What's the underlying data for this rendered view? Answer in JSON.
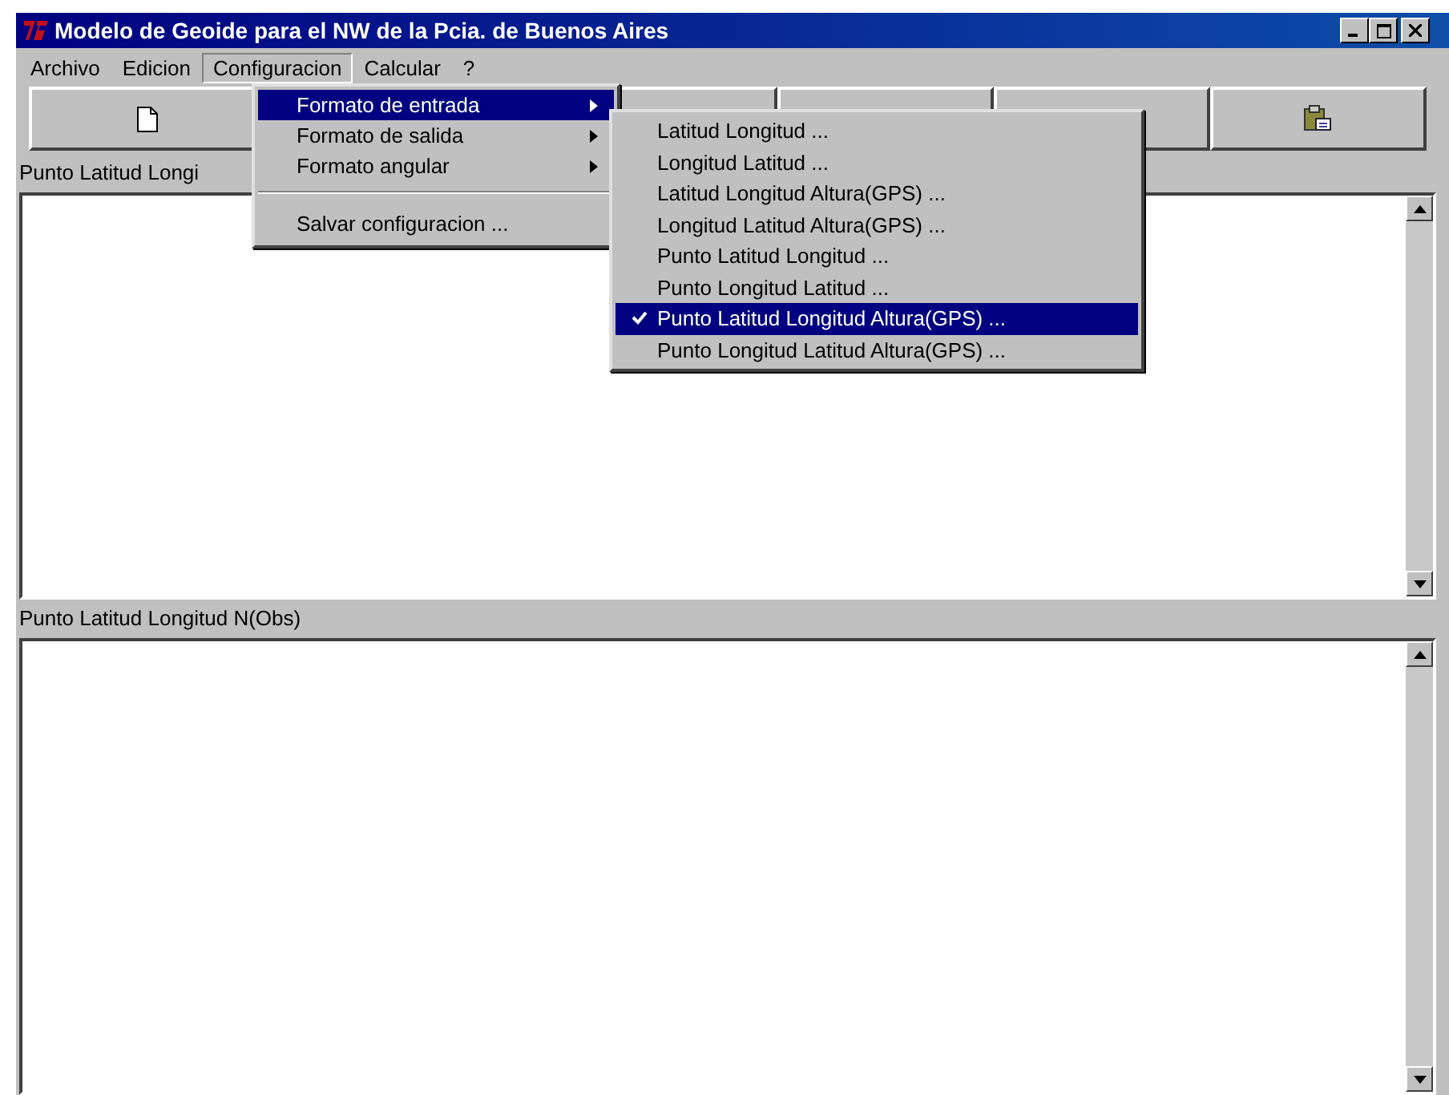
{
  "window": {
    "title": "Modelo de Geoide para el NW de la Pcia. de Buenos Aires"
  },
  "menubar": [
    {
      "label": "Archivo",
      "selected": false
    },
    {
      "label": "Edicion",
      "selected": false
    },
    {
      "label": "Configuracion",
      "selected": true
    },
    {
      "label": "Calcular",
      "selected": false
    },
    {
      "label": "?",
      "selected": false
    }
  ],
  "toolbar": [
    {
      "kind": "new"
    },
    {
      "kind": "blank"
    },
    {
      "kind": "blank"
    },
    {
      "kind": "blank"
    },
    {
      "kind": "paste"
    }
  ],
  "input_panel": {
    "label": "Punto Latitud Longi"
  },
  "output_panel": {
    "label": "Punto Latitud Longitud N(Obs)"
  },
  "config_menu": [
    {
      "kind": "submenu",
      "label": "Formato de entrada",
      "selected": true
    },
    {
      "kind": "submenu",
      "label": "Formato de salida",
      "selected": false
    },
    {
      "kind": "submenu",
      "label": "Formato angular",
      "selected": false
    },
    {
      "kind": "separator"
    },
    {
      "kind": "item",
      "label": "Salvar configuracion ...",
      "selected": false
    }
  ],
  "input_format_menu": [
    {
      "label": "Latitud Longitud ...",
      "checked": false,
      "selected": false
    },
    {
      "label": "Longitud Latitud ...",
      "checked": false,
      "selected": false
    },
    {
      "label": "Latitud Longitud Altura(GPS) ...",
      "checked": false,
      "selected": false
    },
    {
      "label": "Longitud Latitud Altura(GPS) ...",
      "checked": false,
      "selected": false
    },
    {
      "label": "Punto Latitud Longitud ...",
      "checked": false,
      "selected": false
    },
    {
      "label": "Punto Longitud Latitud ...",
      "checked": false,
      "selected": false
    },
    {
      "label": "Punto Latitud Longitud Altura(GPS) ...",
      "checked": true,
      "selected": true
    },
    {
      "label": "Punto Longitud Latitud Altura(GPS) ...",
      "checked": false,
      "selected": false
    }
  ]
}
